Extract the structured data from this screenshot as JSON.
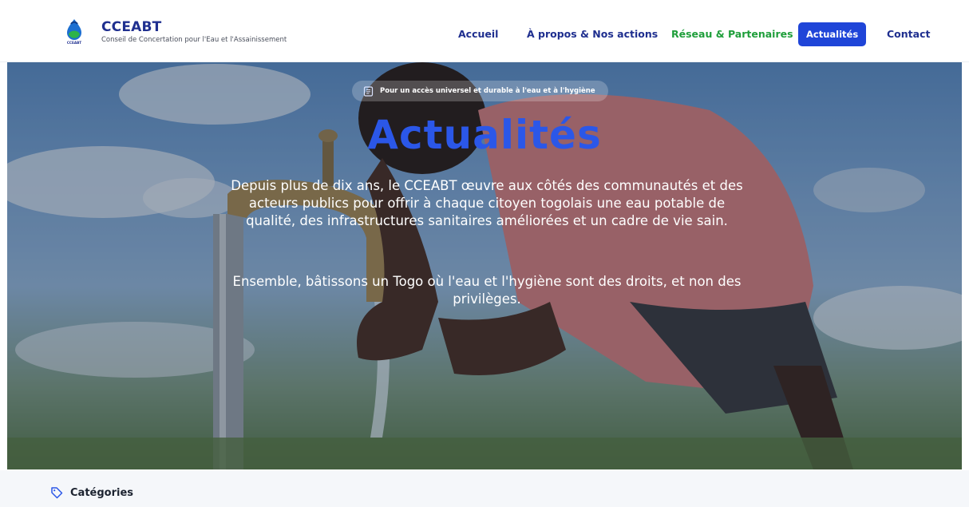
{
  "brand": {
    "name": "CCEABT",
    "subtitle": "Conseil de Concertation pour l'Eau et l'Assainissement",
    "logo_text": "CCEABT"
  },
  "nav": {
    "items": [
      {
        "label": "Accueil",
        "state": "default"
      },
      {
        "label": "À propos & Nos actions",
        "state": "default"
      },
      {
        "label": "Réseau & Partenaires",
        "state": "green"
      },
      {
        "label": "Actualités",
        "state": "active"
      },
      {
        "label": "Contact",
        "state": "default"
      }
    ]
  },
  "hero": {
    "tagline": "Pour un accès universel et durable à l'eau et à l'hygiène",
    "title": "Actualités",
    "paragraph1": "Depuis plus de dix ans, le CCEABT œuvre aux côtés des communautés et des acteurs publics pour offrir à chaque citoyen togolais une eau potable de qualité, des infrastructures sanitaires améliorées et un cadre de vie sain.",
    "paragraph2": "Ensemble, bâtissons un Togo où l'eau et l'hygiène sont des droits, et non des privilèges."
  },
  "categories": {
    "label": "Catégories"
  },
  "colors": {
    "brand_blue": "#1f2f8f",
    "active_blue": "#1f45d8",
    "green": "#1e9e3a",
    "title_blue": "#2b57e8"
  },
  "icons": {
    "logo": "water-drop-logo-icon",
    "tagline": "document-icon",
    "categories": "tag-icon"
  }
}
